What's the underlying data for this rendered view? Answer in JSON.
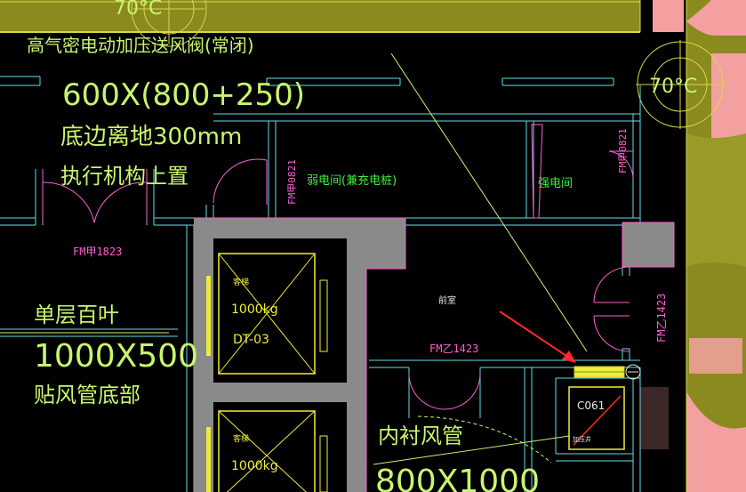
{
  "colors": {
    "background": "#000000",
    "wall": "#5fe0e8",
    "duct": "#8a8a1e",
    "duct_edge": "#d8d84a",
    "pink": "#f5a0a0",
    "grey": "#8a8a8a",
    "magenta": "#ff5fd2",
    "yellow": "#f0ec3c",
    "label_green": "#c8f56e",
    "room_green": "#3cf03c",
    "leader": "#c8f56e",
    "arrow": "#ff2a2a"
  },
  "annotations": {
    "fan_valve_title": "高气密电动加压送风阀(常闭)",
    "fan_valve_size": "600X(800+250)",
    "fan_valve_height": "底边离地300mm",
    "fan_valve_actuator": "执行机构上置",
    "louver_title": "单层百叶",
    "louver_size": "1000X500",
    "louver_note": "贴风管底部",
    "duct_lining": "内衬风管",
    "duct_size": "800X1000",
    "fire_damper_left": "70°C",
    "fire_damper_right": "70°C"
  },
  "doors": {
    "fm1823": "FM甲1823",
    "fm0821_a": "FM甲0821",
    "fm0821_b": "FM甲0821",
    "fm1423_a": "FM乙1423",
    "fm1423_b": "FM乙1423"
  },
  "rooms": {
    "electric_weak": "弱电间(兼充电桩)",
    "electric_strong": "强电间",
    "vestibule": "前室"
  },
  "elevators": {
    "elevator_a_label": "客梯",
    "elevator_a_capacity": "1000kg",
    "elevator_a_id": "DT-03",
    "elevator_b_label": "客梯",
    "elevator_b_capacity": "1000kg"
  },
  "shaft": {
    "code": "C061",
    "note": "加压井"
  }
}
